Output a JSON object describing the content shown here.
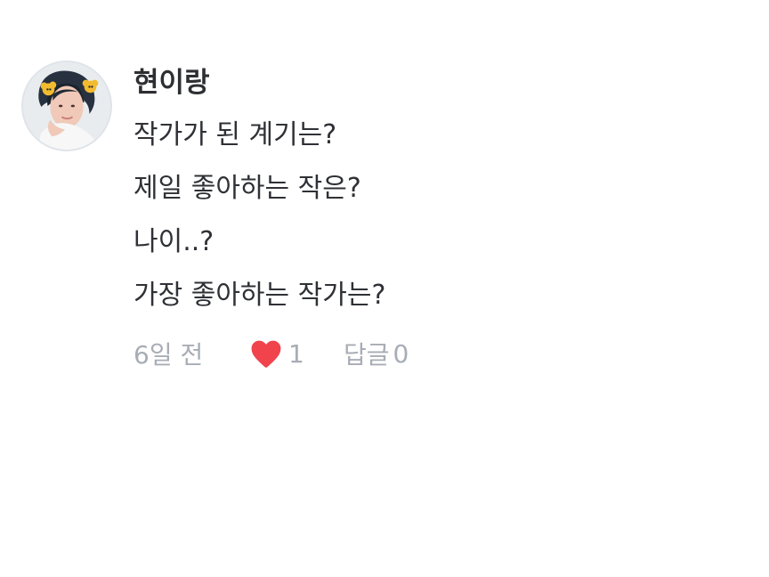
{
  "comment": {
    "author": "현이랑",
    "lines": [
      "작가가 된 계기는?",
      "제일 좋아하는 작은?",
      "나이..?",
      "가장 좋아하는 작가는?"
    ],
    "time": "6일 전",
    "like_count": "1",
    "reply_label": "답글",
    "reply_count": "0"
  },
  "icons": {
    "heart": "heart-icon",
    "avatar": "avatar"
  },
  "colors": {
    "heart": "#f0434b",
    "meta": "#a8adb5",
    "text": "#2f3136"
  }
}
